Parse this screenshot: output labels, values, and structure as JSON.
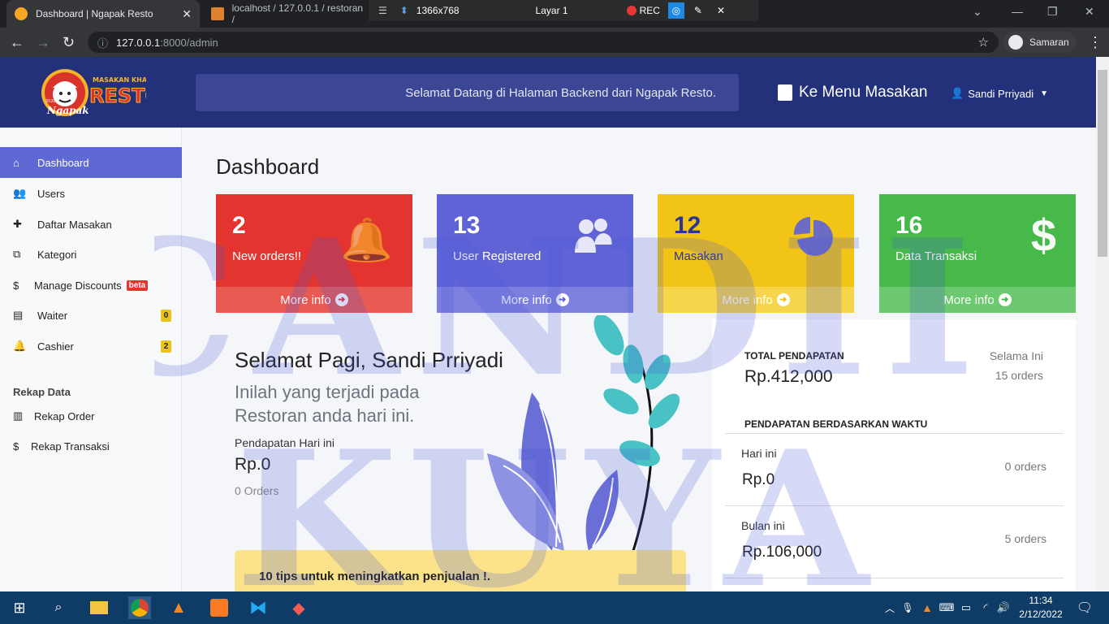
{
  "browser": {
    "tabs": [
      {
        "title": "Dashboard | Ngapak Resto",
        "active": true
      },
      {
        "title": "localhost / 127.0.0.1 / restoran /",
        "active": false
      }
    ],
    "recorder": {
      "resolution": "1366x768",
      "layer": "Layar 1",
      "rec": "REC"
    },
    "url_host": "127.0.0.1",
    "url_path": ":8000/admin",
    "profile": "Samaran"
  },
  "header": {
    "logo_text_top": "MASAKAN KHAS",
    "logo_text_main": "RESTO",
    "logo_text_script": "Ngapak",
    "logo_year": "2020",
    "welcome": "Selamat Datang di Halaman Backend dari Ngapak Resto.",
    "menu_link": "Ke Menu Masakan",
    "user": "Sandi Prriyadi"
  },
  "sidebar": {
    "items": [
      {
        "label": "Dashboard",
        "icon": "home-icon"
      },
      {
        "label": "Users",
        "icon": "users-icon"
      },
      {
        "label": "Daftar Masakan",
        "icon": "puzzle-icon"
      },
      {
        "label": "Kategori",
        "icon": "tags-icon"
      },
      {
        "label": "Manage Discounts",
        "icon": "dollar-icon",
        "badge": "beta"
      },
      {
        "label": "Waiter",
        "icon": "clipboard-icon",
        "badge": "0"
      },
      {
        "label": "Cashier",
        "icon": "bell-icon",
        "badge": "2"
      }
    ],
    "section_title": "Rekap Data",
    "rekap_items": [
      {
        "label": "Rekap Order",
        "icon": "chart-icon"
      },
      {
        "label": "Rekap Transaksi",
        "icon": "dollar-icon"
      }
    ]
  },
  "main": {
    "title": "Dashboard",
    "cards": [
      {
        "value": "2",
        "label": "New orders!!",
        "footer": "More info",
        "color": "#e3342f",
        "icon": "bell-icon"
      },
      {
        "value": "13",
        "label": "User Registered",
        "footer": "More info",
        "color": "#5f63d6",
        "icon": "users-icon"
      },
      {
        "value": "12",
        "label": "Masakan",
        "footer": "More info",
        "color": "#f2c415",
        "icon": "pie-chart-icon"
      },
      {
        "value": "16",
        "label": "Data Transaksi",
        "footer": "More info",
        "color": "#46b94a",
        "icon": "dollar-icon"
      }
    ],
    "greeting": "Selamat Pagi, Sandi Prriyadi",
    "greeting_sub": "Inilah yang terjadi pada Restoran anda hari ini.",
    "revenue_label": "Pendapatan Hari ini",
    "revenue_value": "Rp.0",
    "revenue_orders": "0 Orders",
    "tips": "10 tips untuk meningkatkan penjualan !."
  },
  "stats": {
    "total_label": "TOTAL PENDAPATAN",
    "total_value": "Rp.412,000",
    "total_period": "Selama Ini",
    "total_orders": "15 orders",
    "by_time_label": "PENDAPATAN BERDASARKAN WAKTU",
    "rows": [
      {
        "period": "Hari ini",
        "value": "Rp.0",
        "orders": "0 orders"
      },
      {
        "period": "Bulan ini",
        "value": "Rp.106,000",
        "orders": "5 orders"
      }
    ]
  },
  "watermark": {
    "line1": "CANDIL",
    "line2": "KUYA"
  },
  "taskbar": {
    "time": "11:34",
    "date": "2/12/2022"
  }
}
